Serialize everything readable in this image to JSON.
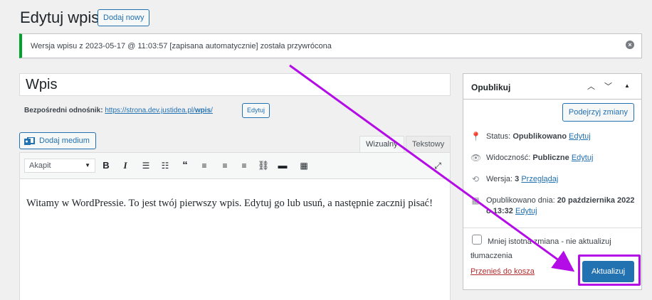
{
  "header": {
    "title": "Edytuj wpis",
    "add_new_label": "Dodaj nowy"
  },
  "notice": {
    "text": "Wersja wpisu z 2023-05-17 @ 11:03:57 [zapisana automatycznie] została przywrócona",
    "dismiss_icon": "dismiss-icon"
  },
  "post": {
    "title_value": "Wpis",
    "permalink_label": "Bezpośredni odnośnik:",
    "permalink_base": "https://strona.dev.justidea.pl/",
    "permalink_slug": "wpis",
    "permalink_trailing": "/",
    "edit_slug_label": "Edytuj"
  },
  "editor": {
    "add_media_label": "Dodaj medium",
    "tab_visual": "Wizualny",
    "tab_text": "Tekstowy",
    "format_value": "Akapit",
    "content": "Witamy w WordPressie. To jest twój pierwszy wpis. Edytuj go lub usuń, a następnie zacznij pisać!"
  },
  "publish": {
    "title": "Opublikuj",
    "preview_label": "Podejrzyj zmiany",
    "status_label": "Status:",
    "status_value": "Opublikowano",
    "status_edit": "Edytuj",
    "visibility_label": "Widoczność:",
    "visibility_value": "Publiczne",
    "visibility_edit": "Edytuj",
    "revisions_label": "Wersja:",
    "revisions_value": "3",
    "revisions_link": "Przeglądaj",
    "published_label": "Opublikowano dnia:",
    "published_value": "20 października 2022 o 13:32",
    "published_edit": "Edytuj",
    "minor_label": "Mniej istotna zmiana - nie aktualizuj tłumaczenia",
    "trash_label": "Przenieś do kosza",
    "update_label": "Aktualizuj"
  },
  "colors": {
    "accent": "#2271b1",
    "success": "#00a32a",
    "annotation": "#b30ce6",
    "danger": "#b32d2e"
  }
}
